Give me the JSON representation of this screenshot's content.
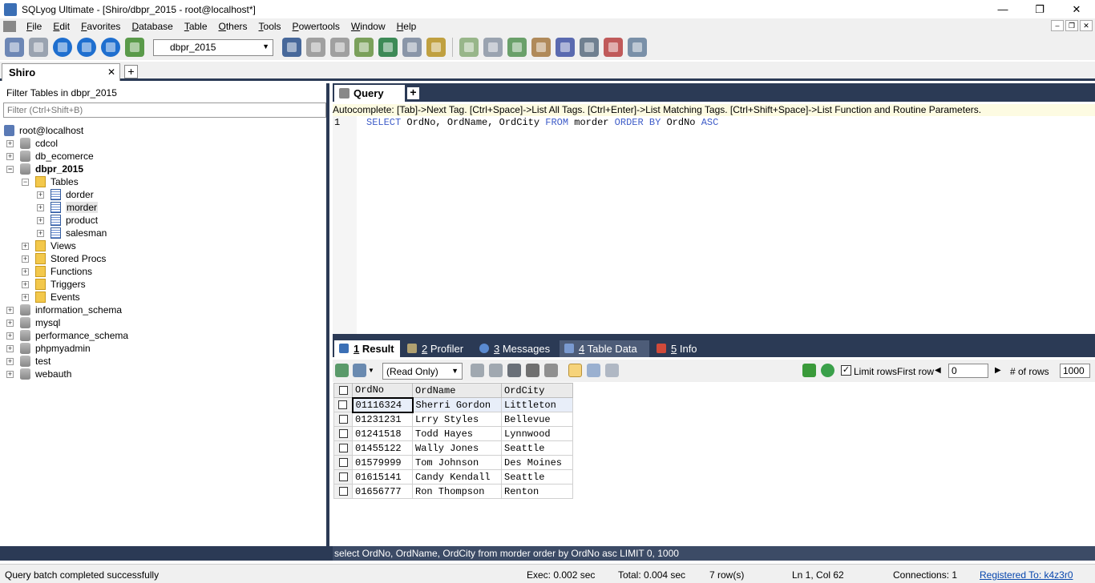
{
  "window": {
    "title": "SQLyog Ultimate - [Shiro/dbpr_2015 - root@localhost*]"
  },
  "menu": [
    "File",
    "Edit",
    "Favorites",
    "Database",
    "Table",
    "Others",
    "Tools",
    "Powertools",
    "Window",
    "Help"
  ],
  "toolbar": {
    "database_select": "dbpr_2015"
  },
  "connection_tab": {
    "label": "Shiro",
    "close": "✕",
    "add": "+"
  },
  "object_browser": {
    "filter_label": "Filter Tables in dbpr_2015",
    "filter_placeholder": "Filter (Ctrl+Shift+B)",
    "server": "root@localhost",
    "nodes": [
      {
        "label": "cdcol"
      },
      {
        "label": "db_ecomerce"
      },
      {
        "label": "dbpr_2015"
      },
      {
        "label": "Tables"
      },
      {
        "label": "dorder"
      },
      {
        "label": "morder"
      },
      {
        "label": "product"
      },
      {
        "label": "salesman"
      },
      {
        "label": "Views"
      },
      {
        "label": "Stored Procs"
      },
      {
        "label": "Functions"
      },
      {
        "label": "Triggers"
      },
      {
        "label": "Events"
      },
      {
        "label": "information_schema"
      },
      {
        "label": "mysql"
      },
      {
        "label": "performance_schema"
      },
      {
        "label": "phpmyadmin"
      },
      {
        "label": "test"
      },
      {
        "label": "webauth"
      }
    ]
  },
  "query_tab": {
    "label": "Query"
  },
  "autocomplete_hint": "Autocomplete: [Tab]->Next Tag. [Ctrl+Space]->List All Tags. [Ctrl+Enter]->List Matching Tags. [Ctrl+Shift+Space]->List Function and Routine Parameters.",
  "editor": {
    "line_number": "1",
    "kw_select": "SELECT",
    "columns": " OrdNo, OrdName, OrdCity ",
    "kw_from": "FROM",
    "table": " morder ",
    "kw_order": "ORDER BY",
    "order_col": " OrdNo ",
    "kw_asc": "ASC"
  },
  "result_tabs": [
    {
      "num": "1",
      "label": " Result"
    },
    {
      "num": "2",
      "label": " Profiler"
    },
    {
      "num": "3",
      "label": " Messages"
    },
    {
      "num": "4",
      "label": " Table Data"
    },
    {
      "num": "5",
      "label": " Info"
    }
  ],
  "result_toolbar": {
    "mode": "(Read Only)",
    "limit_rows_label": "Limit rows",
    "limit_checked": "✓",
    "first_row_label": "First row",
    "first_row_value": "0",
    "num_rows_label": "# of rows",
    "num_rows_value": "1000"
  },
  "result_grid": {
    "columns": [
      "OrdNo",
      "OrdName",
      "OrdCity"
    ],
    "rows": [
      [
        "01116324",
        "Sherri Gordon",
        "Littleton"
      ],
      [
        "01231231",
        "Lrry Styles",
        "Bellevue"
      ],
      [
        "01241518",
        "Todd Hayes",
        "Lynnwood"
      ],
      [
        "01455122",
        "Wally Jones",
        "Seattle"
      ],
      [
        "01579999",
        "Tom Johnson",
        "Des Moines"
      ],
      [
        "01615141",
        "Candy Kendall",
        "Seattle"
      ],
      [
        "01656777",
        "Ron Thompson",
        "Renton"
      ]
    ]
  },
  "executed_query": "select OrdNo, OrdName, OrdCity from morder order by OrdNo asc LIMIT 0, 1000",
  "status": {
    "message": "Query batch completed successfully",
    "exec": "Exec: 0.002 sec",
    "total": "Total: 0.004 sec",
    "rows": "7 row(s)",
    "position": "Ln 1, Col 62",
    "connections": "Connections: 1",
    "registered": "Registered To: k4z3r0"
  }
}
